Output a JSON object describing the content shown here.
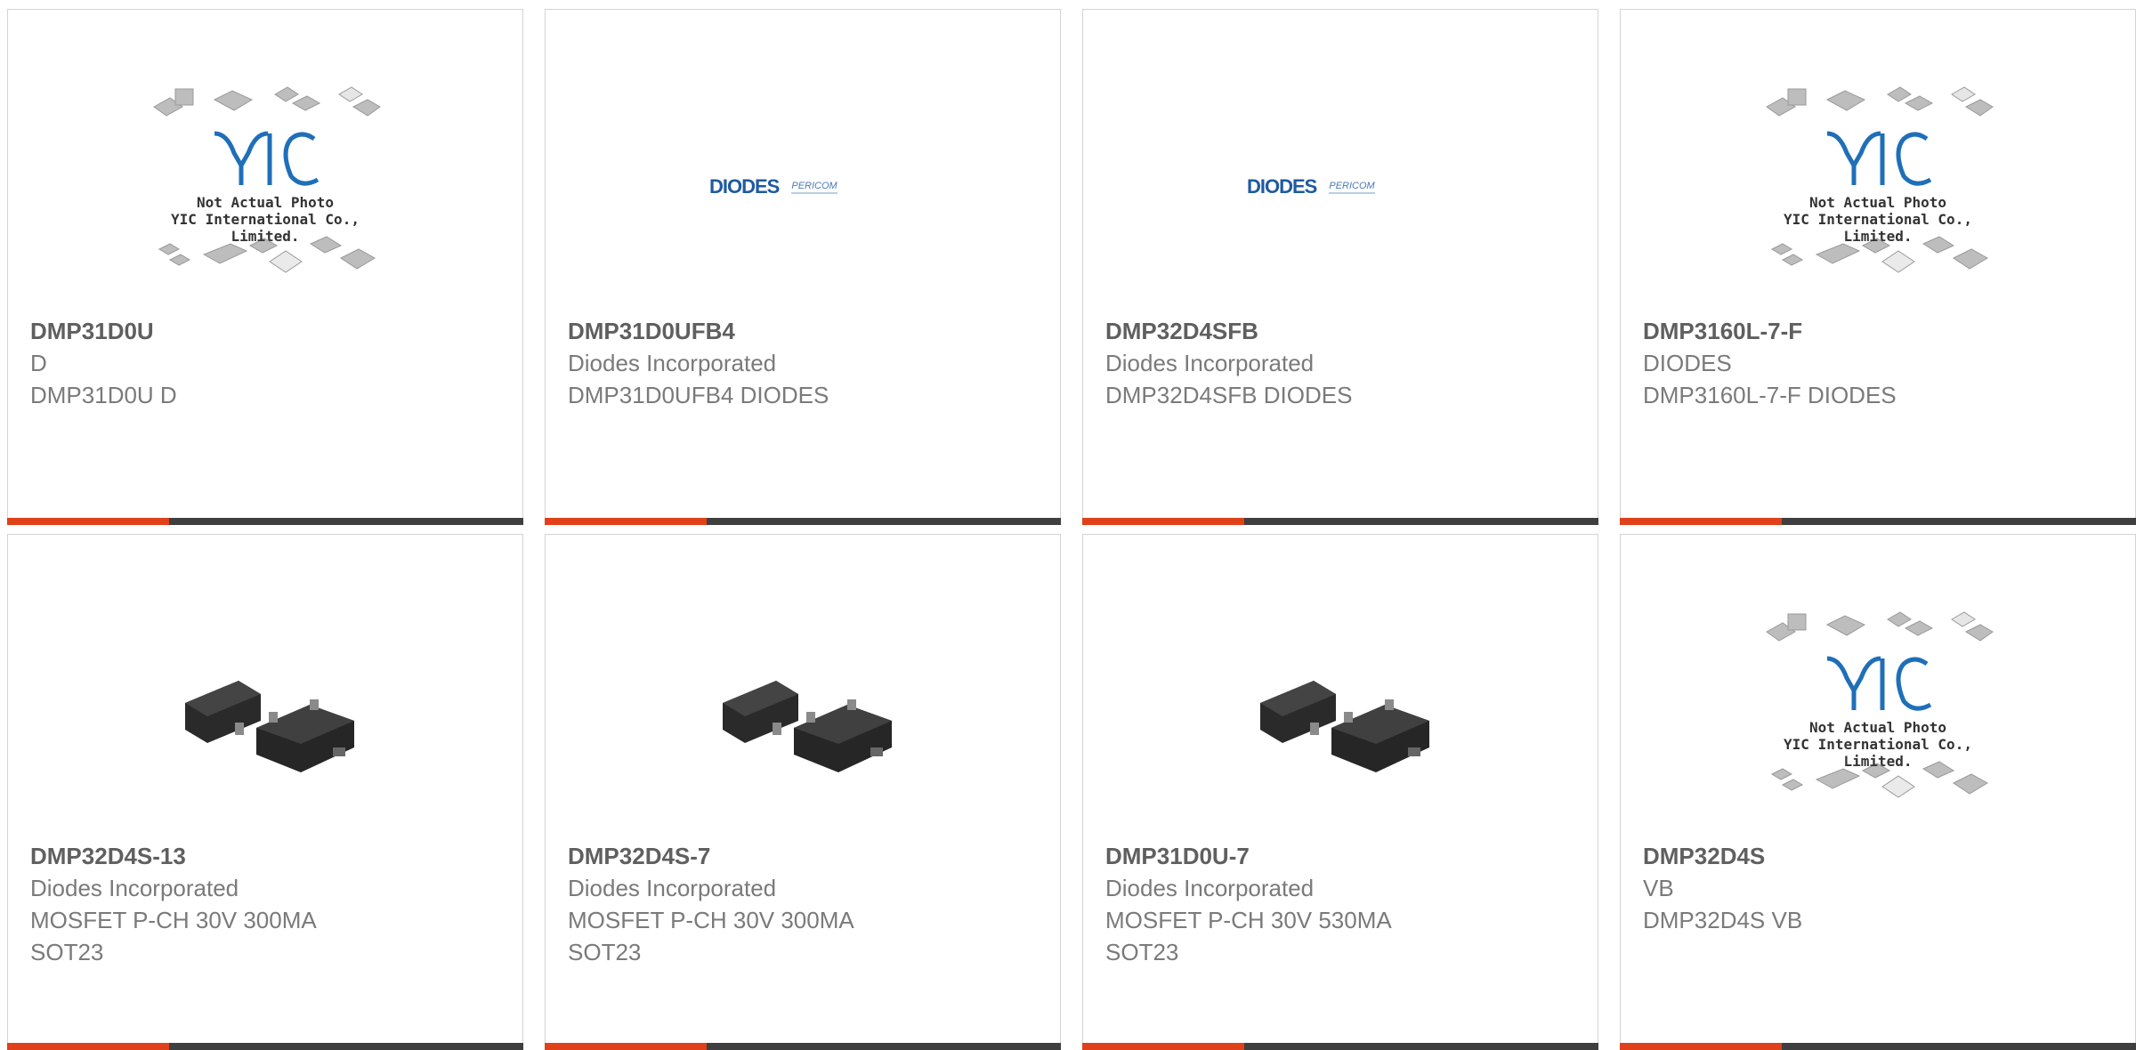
{
  "products": [
    {
      "part": "DMP31D0U",
      "maker": "D",
      "desc": [
        "DMP31D0U D"
      ],
      "image": "yic-placeholder",
      "image_text": [
        "Not Actual Photo",
        "YIC International Co., Limited."
      ]
    },
    {
      "part": "DMP31D0UFB4",
      "maker": "Diodes Incorporated",
      "desc": [
        "DMP31D0UFB4 DIODES"
      ],
      "image": "diodes-logo",
      "image_text": [
        "DIODES",
        "PERICOM"
      ]
    },
    {
      "part": "DMP32D4SFB",
      "maker": "Diodes Incorporated",
      "desc": [
        "DMP32D4SFB DIODES"
      ],
      "image": "diodes-logo",
      "image_text": [
        "DIODES",
        "PERICOM"
      ]
    },
    {
      "part": "DMP3160L-7-F",
      "maker": "DIODES",
      "desc": [
        "DMP3160L-7-F DIODES"
      ],
      "image": "yic-placeholder",
      "image_text": [
        "Not Actual Photo",
        "YIC International Co., Limited."
      ]
    },
    {
      "part": "DMP32D4S-13",
      "maker": "Diodes Incorporated",
      "desc": [
        "MOSFET P-CH 30V 300MA",
        "SOT23"
      ],
      "image": "sot23-photo"
    },
    {
      "part": "DMP32D4S-7",
      "maker": "Diodes Incorporated",
      "desc": [
        "MOSFET P-CH 30V 300MA",
        "SOT23"
      ],
      "image": "sot23-photo"
    },
    {
      "part": "DMP31D0U-7",
      "maker": "Diodes Incorporated",
      "desc": [
        "MOSFET P-CH 30V 530MA",
        "SOT23"
      ],
      "image": "sot23-photo"
    },
    {
      "part": "DMP32D4S",
      "maker": "VB",
      "desc": [
        "DMP32D4S VB"
      ],
      "image": "yic-placeholder",
      "image_text": [
        "Not Actual Photo",
        "YIC International Co., Limited."
      ]
    }
  ],
  "colors": {
    "accent": "#e0401a",
    "bar": "#3f3f3f",
    "border": "#d4d4d4",
    "text": "#7a7a7a"
  }
}
